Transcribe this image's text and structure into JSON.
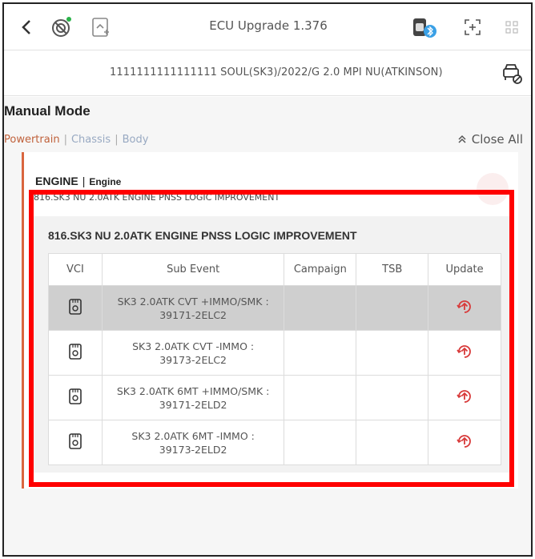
{
  "header": {
    "title": "ECU Upgrade 1.376",
    "icons": [
      "back-icon",
      "vci-connection-icon",
      "screen-capture-icon",
      "vci-bluetooth-icon",
      "fullscreen-icon",
      "menu-grid-icon"
    ]
  },
  "vehicle": {
    "info": "1111111111111111  SOUL(SK3)/2022/G 2.0 MPI NU(ATKINSON)",
    "icon": "vehicle-settings-icon"
  },
  "main": {
    "mode_title": "Manual Mode",
    "tabs": [
      {
        "label": "Powertrain",
        "color": "#c0613b"
      },
      {
        "label": "Chassis",
        "color": "#98a9c2"
      },
      {
        "label": "Body",
        "color": "#98a9c2"
      }
    ],
    "tab_separator": "|",
    "close_all": "Close All"
  },
  "engine": {
    "system": "ENGINE",
    "separator": "|",
    "system_sub": "Engine",
    "event_line": "816.SK3 NU 2.0ATK ENGINE PNSS LOGIC IMPROVEMENT",
    "event_title": "816.SK3 NU 2.0ATK ENGINE PNSS LOGIC IMPROVEMENT"
  },
  "table": {
    "headers": [
      "VCI",
      "Sub Event",
      "Campaign",
      "TSB",
      "Update"
    ],
    "rows": [
      {
        "sub_event_line1": "SK3 2.0ATK CVT +IMMO/SMK :",
        "sub_event_line2": "39171-2ELC2",
        "campaign": "",
        "tsb": "",
        "selected": true
      },
      {
        "sub_event_line1": "SK3 2.0ATK CVT -IMMO :",
        "sub_event_line2": "39173-2ELC2",
        "campaign": "",
        "tsb": "",
        "selected": false
      },
      {
        "sub_event_line1": "SK3 2.0ATK 6MT +IMMO/SMK :",
        "sub_event_line2": "39171-2ELD2",
        "campaign": "",
        "tsb": "",
        "selected": false
      },
      {
        "sub_event_line1": "SK3 2.0ATK 6MT -IMMO :",
        "sub_event_line2": "39173-2ELD2",
        "campaign": "",
        "tsb": "",
        "selected": false
      }
    ]
  },
  "colors": {
    "accent_orange": "#d9663f",
    "update_red": "#d83a3a",
    "highlight_red": "#ff0000",
    "selected_row": "#cfcfcf"
  }
}
